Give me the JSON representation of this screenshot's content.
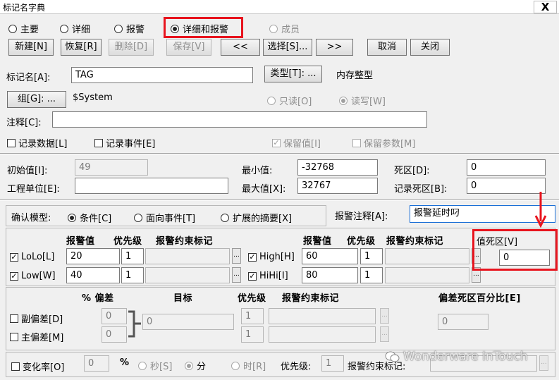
{
  "window": {
    "title": "标记名字典",
    "close_glyph": "X"
  },
  "view_modes": [
    {
      "label": "主要",
      "selected": false
    },
    {
      "label": "详细",
      "selected": false
    },
    {
      "label": "报警",
      "selected": false
    },
    {
      "label": "详细和报警",
      "selected": true
    },
    {
      "label": "成员",
      "selected": false,
      "disabled": true
    }
  ],
  "toolbar": {
    "new": "新建[N]",
    "restore": "恢复[R]",
    "delete": "删除[D]",
    "save": "保存[V]",
    "prev": "<<",
    "select": "选择[S]...",
    "next": ">>",
    "cancel": "取消",
    "close": "关闭"
  },
  "tag": {
    "name_label": "标记名[A]:",
    "name_value": "TAG",
    "type_button": "类型[T]: ...",
    "type_value": "内存整型",
    "group_button": "组[G]: ...",
    "group_value": "$System",
    "readonly": "只读[O]",
    "readwrite": "读写[W]",
    "comment_label": "注释[C]:",
    "comment_value": "",
    "log_data": "记录数据[L]",
    "log_events": "记录事件[E]",
    "retentive_value": "保留值[I]",
    "retentive_params": "保留参数[M]"
  },
  "details": {
    "initial_label": "初始值[I]:",
    "initial_value": "49",
    "min_label": "最小值:",
    "min_value": "-32768",
    "deadband_label": "死区[D]:",
    "deadband_value": "0",
    "eng_units_label": "工程单位[E]:",
    "eng_units_value": "",
    "max_label": "最大值[X]:",
    "max_value": "32767",
    "log_deadband_label": "记录死区[B]:",
    "log_deadband_value": "0"
  },
  "alarm": {
    "ack_model_label": "确认模型:",
    "ack_condition": "条件[C]",
    "ack_event": "面向事件[T]",
    "ack_expanded": "扩展的摘要[X]",
    "comment_label": "报警注释[A]:",
    "comment_value": "报警延时叼",
    "col_value": "报警值",
    "col_priority": "优先级",
    "col_inhibitor": "报警约束标记",
    "lolo_label": "LoLo[L]",
    "lolo_value": "20",
    "lolo_priority": "1",
    "low_label": "Low[W]",
    "low_value": "40",
    "low_priority": "1",
    "high_label": "High[H]",
    "high_value": "60",
    "high_priority": "1",
    "hihi_label": "HiHi[I]",
    "hihi_value": "80",
    "hihi_priority": "1",
    "value_deadband_label": "值死区[V]",
    "value_deadband_value": "0",
    "pct_dev_label": "% 偏差",
    "target_label": "目标",
    "priority_label": "优先级",
    "inhibitor_label": "报警约束标记",
    "dev_deadband_label": "偏差死区百分比[E]",
    "minor_dev_label": "副偏差[D]",
    "minor_dev_value": "0",
    "minor_dev_priority": "1",
    "major_dev_label": "主偏差[M]",
    "major_dev_value": "0",
    "major_dev_priority": "1",
    "target_value": "0",
    "dev_deadband_value": "0",
    "roc_label": "变化率[O]",
    "roc_value": "0",
    "pct_symbol": "%",
    "sec": "秒[S]",
    "min": "分",
    "hour": "时[R]",
    "roc_priority_label": "优先级:",
    "roc_priority_value": "1",
    "roc_inhibitor_label": "报警约束标记:"
  },
  "watermark": "Wonderware InTouch",
  "colors": {
    "highlight": "#e8141e"
  }
}
